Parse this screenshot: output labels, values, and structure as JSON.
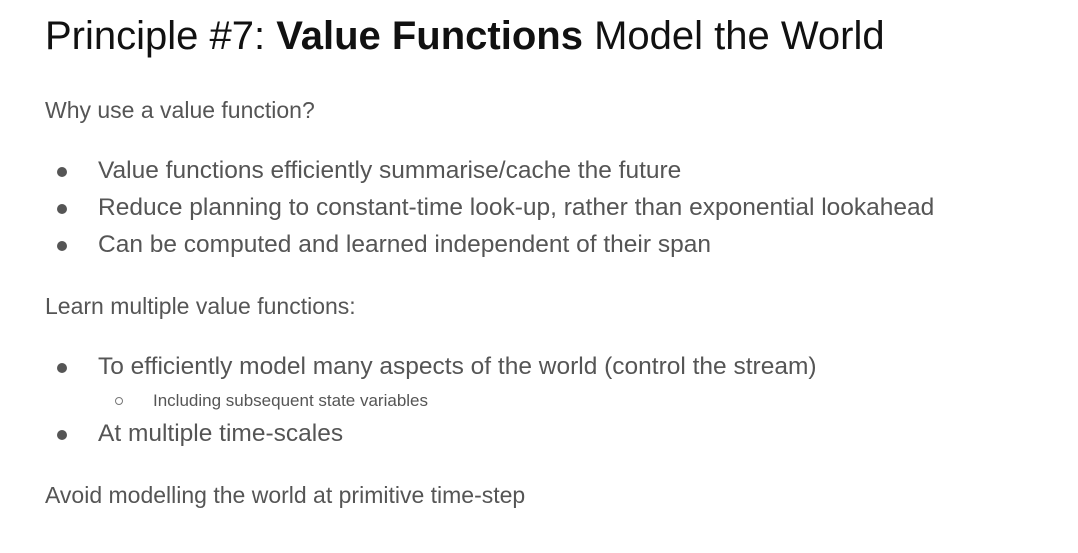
{
  "title": {
    "prefix": "Principle #7: ",
    "bold": "Value Functions",
    "suffix": " Model the World"
  },
  "sections": [
    {
      "heading": "Why use a value function?",
      "bullets": [
        "Value functions efficiently summarise/cache the future",
        "Reduce planning to constant-time look-up, rather than exponential lookahead",
        "Can be computed and learned independent of their span"
      ]
    },
    {
      "heading": "Learn multiple value functions:",
      "bullets": [
        "To efficiently model many aspects of the world (control the stream)",
        "At multiple time-scales"
      ],
      "sub_bullet": "Including subsequent state variables"
    }
  ],
  "closing": "Avoid modelling the world at primitive time-step"
}
